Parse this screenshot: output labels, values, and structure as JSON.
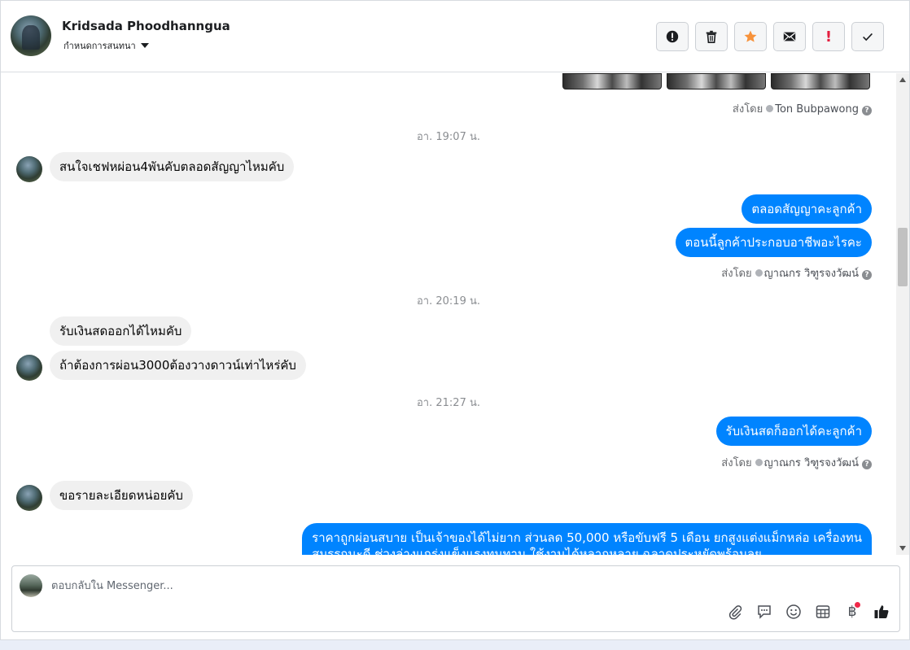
{
  "header": {
    "contact_name": "Kridsada Phoodhanngua",
    "assign_label": "กำหนดการสนทนา",
    "actions": [
      {
        "name": "spam-button",
        "icon": "alert-circle-icon"
      },
      {
        "name": "delete-button",
        "icon": "trash-icon"
      },
      {
        "name": "star-button",
        "icon": "star-icon",
        "color": "#f7923b"
      },
      {
        "name": "mark-unread-button",
        "icon": "envelope-icon"
      },
      {
        "name": "follow-up-button",
        "icon": "exclamation-icon",
        "text": "!"
      },
      {
        "name": "mark-done-button",
        "icon": "checkmark-icon"
      }
    ]
  },
  "thread": {
    "sent_by_1": {
      "prefix": "ส่งโดย",
      "name": "Ton Bubpawong"
    },
    "time_1": "อา. 19:07 น.",
    "msg_in_1": "สนใจเชฟหผ่อน4พันคับตลอดสัญญาไหมคับ",
    "msg_out_1": "ตลอดสัญญาคะลูกค้า",
    "msg_out_2": "ตอนนี้ลูกค้าประกอบอาชีพอะไรคะ",
    "sent_by_2": {
      "prefix": "ส่งโดย",
      "name": "ญาณกร วิฑูรจงวัฒน์"
    },
    "time_2": "อา. 20:19 น.",
    "msg_in_2": "รับเงินสดออกได้ไหมคับ",
    "msg_in_3": "ถ้าต้องการผ่อน3000ต้องวางดาวน์เท่าไหร่คับ",
    "time_3": "อา. 21:27 น.",
    "msg_out_3": "รับเงินสดก็ออกได้คะลูกค้า",
    "sent_by_3": {
      "prefix": "ส่งโดย",
      "name": "ญาณกร วิฑูรจงวัฒน์"
    },
    "msg_in_4": "ขอรายละเอียดหน่อยคับ",
    "msg_out_4_line1": "ราคาถูกผ่อนสบาย เป็นเจ้าของได้ไม่ยาก ส่วนลด 50,000 หรือขับฟรี 5 เดือน ยกสูงแต่งแม็กหล่อ เครื่องทน",
    "msg_out_4_line2": "สมรรถนะดี ช่วงล่างแกร่งแข็งแรงทนทาน ใช้งานได้หลากหลาย ฉลาดประหยัดพร้อมลุย"
  },
  "composer": {
    "placeholder": "ตอบกลับใน Messenger...",
    "currency_symbol": "฿",
    "tools": [
      "paperclip-icon",
      "saved-reply-icon",
      "emoji-icon",
      "appointment-icon",
      "payment-icon",
      "like-icon"
    ]
  },
  "colors": {
    "outgoing_bubble": "#0084ff",
    "incoming_bubble": "#f0f0f0",
    "star": "#f7923b",
    "alert": "#e41e3f",
    "badge": "#f02849"
  }
}
